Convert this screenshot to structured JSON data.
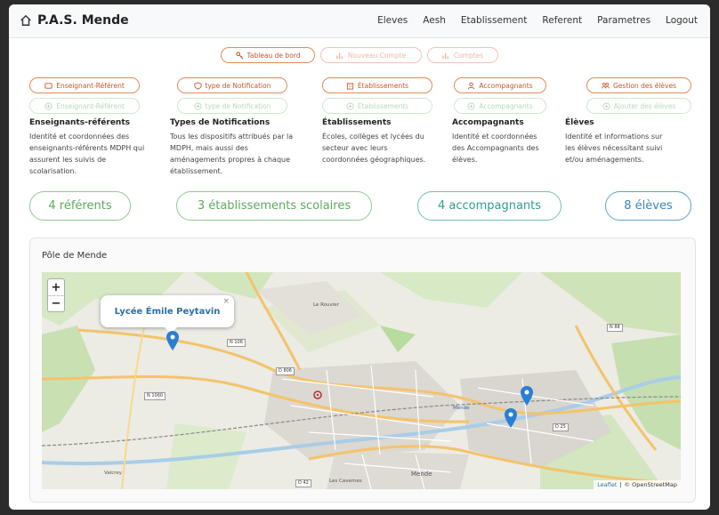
{
  "brand": {
    "title": "P.A.S. Mende",
    "icon": "home-icon"
  },
  "nav": {
    "items": [
      "Eleves",
      "Aesh",
      "Etablissement",
      "Referent",
      "Parametres",
      "Logout"
    ]
  },
  "top_buttons": {
    "dashboard": "Tableau de bord",
    "new_account": "Nouveau Compte",
    "accounts": "Comptes"
  },
  "columns": [
    {
      "main_button": "Enseignant-Référent",
      "add_button": "Enseignant-Référent",
      "title": "Enseignants-référents",
      "desc": [
        "Identité et coordonnées des",
        "enseignants-référents MDPH qui",
        "assurent les suivis de",
        "scolarisation."
      ]
    },
    {
      "main_button": "type de Notification",
      "add_button": "type de Notification",
      "title": "Types de Notifications",
      "desc": [
        "Tous les dispositifs attribués par la",
        "MDPH, mais aussi des",
        "aménagements propres à chaque",
        "établissement."
      ]
    },
    {
      "main_button": "Établissements",
      "add_button": "Établissements",
      "title": "Établissements",
      "desc": [
        "Écoles, collèges et lycées du",
        "secteur avec leurs",
        "coordonnées géographiques."
      ]
    },
    {
      "main_button": "Accompagnants",
      "add_button": "Accompagnants",
      "title": "Accompagnants",
      "desc": [
        "Identité et coordonnées",
        "des Accompagnants des",
        "élèves."
      ]
    },
    {
      "main_button": "Gestion des élèves",
      "add_button": "Ajouter des élèves",
      "title": "Élèves",
      "desc": [
        "Identité et informations sur",
        "les élèves nécessitant suivi",
        "et/ou aménagements."
      ]
    }
  ],
  "counts": {
    "referents": "4 référents",
    "etablissements": "3 établissements scolaires",
    "accompagnants": "4 accompagnants",
    "eleves": "8 élèves"
  },
  "map_card": {
    "title": "Pôle de Mende",
    "zoom_in": "+",
    "zoom_out": "−",
    "popup_title": "Lycée Émile Peytavin",
    "popup_close": "×",
    "attribution_leaflet": "Leaflet",
    "attribution_sep": "|",
    "attribution_osm": "© OpenStreetMap",
    "labels": {
      "mende": "Mende",
      "mende2": "Mende",
      "le_rouvier": "Le Rouvier",
      "les_cavernes": "Les Cavernes",
      "valcrey": "Valcrey",
      "n106": "N 106",
      "n1060": "N 1060",
      "d806": "D 806",
      "n88": "N 88",
      "d42": "D 42",
      "d25": "D 25"
    }
  },
  "colors": {
    "accent_orange": "#c7572c",
    "green": "#5da85d",
    "teal": "#2f9c8f",
    "blue": "#3a87b3",
    "marker": "#2a7fd4"
  }
}
